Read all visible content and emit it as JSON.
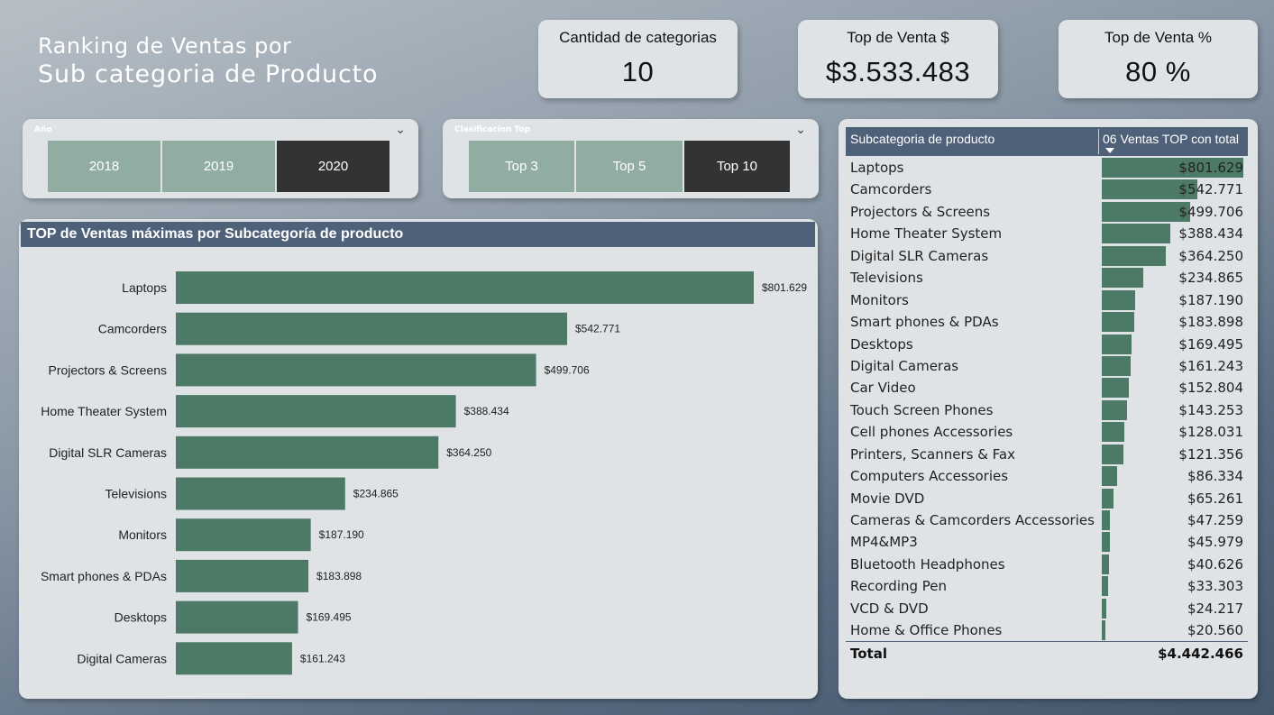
{
  "title": {
    "line1": "Ranking de Ventas por",
    "line2": "Sub categoria de Producto"
  },
  "kpis": [
    {
      "label": "Cantidad de categorias",
      "value": "10"
    },
    {
      "label": "Top de Venta $",
      "value": "$3.533.483"
    },
    {
      "label": "Top de Venta %",
      "value": "80 %"
    }
  ],
  "slicer_year": {
    "label": "Año",
    "options": [
      "2018",
      "2019",
      "2020"
    ],
    "selected": "2020"
  },
  "slicer_top": {
    "label": "Clasificacion Top",
    "options": [
      "Top 3",
      "Top 5",
      "Top 10"
    ],
    "selected": "Top 10"
  },
  "colors": {
    "bar": "#4d7a66",
    "header": "#4e6178",
    "selected_btn": "#333333",
    "btn": "#91ada1"
  },
  "chart_data": {
    "type": "bar",
    "orientation": "horizontal",
    "title": "TOP de Ventas máximas por Subcategoría de producto",
    "categories": [
      "Laptops",
      "Camcorders",
      "Projectors & Screens",
      "Home Theater System",
      "Digital SLR Cameras",
      "Televisions",
      "Monitors",
      "Smart phones & PDAs",
      "Desktops",
      "Digital Cameras"
    ],
    "values": [
      801629,
      542771,
      499706,
      388434,
      364250,
      234865,
      187190,
      183898,
      169495,
      161243
    ],
    "labels": [
      "$801.629",
      "$542.771",
      "$499.706",
      "$388.434",
      "$364.250",
      "$234.865",
      "$187.190",
      "$183.898",
      "$169.495",
      "$161.243"
    ],
    "xlim": [
      0,
      801629
    ],
    "grid": false
  },
  "table": {
    "headers": [
      "Subcategoria de producto",
      "06 Ventas TOP con total"
    ],
    "rows": [
      {
        "name": "Laptops",
        "value": 801629,
        "label": "$801.629"
      },
      {
        "name": "Camcorders",
        "value": 542771,
        "label": "$542.771"
      },
      {
        "name": "Projectors & Screens",
        "value": 499706,
        "label": "$499.706"
      },
      {
        "name": "Home Theater System",
        "value": 388434,
        "label": "$388.434"
      },
      {
        "name": "Digital SLR Cameras",
        "value": 364250,
        "label": "$364.250"
      },
      {
        "name": "Televisions",
        "value": 234865,
        "label": "$234.865"
      },
      {
        "name": "Monitors",
        "value": 187190,
        "label": "$187.190"
      },
      {
        "name": "Smart phones & PDAs",
        "value": 183898,
        "label": "$183.898"
      },
      {
        "name": "Desktops",
        "value": 169495,
        "label": "$169.495"
      },
      {
        "name": "Digital Cameras",
        "value": 161243,
        "label": "$161.243"
      },
      {
        "name": "Car Video",
        "value": 152804,
        "label": "$152.804"
      },
      {
        "name": "Touch Screen Phones",
        "value": 143253,
        "label": "$143.253"
      },
      {
        "name": "Cell phones Accessories",
        "value": 128031,
        "label": "$128.031"
      },
      {
        "name": "Printers, Scanners & Fax",
        "value": 121356,
        "label": "$121.356"
      },
      {
        "name": "Computers Accessories",
        "value": 86334,
        "label": "$86.334"
      },
      {
        "name": "Movie DVD",
        "value": 65261,
        "label": "$65.261"
      },
      {
        "name": "Cameras & Camcorders Accessories",
        "value": 47259,
        "label": "$47.259"
      },
      {
        "name": "MP4&MP3",
        "value": 45979,
        "label": "$45.979"
      },
      {
        "name": "Bluetooth Headphones",
        "value": 40626,
        "label": "$40.626"
      },
      {
        "name": "Recording Pen",
        "value": 33303,
        "label": "$33.303"
      },
      {
        "name": "VCD & DVD",
        "value": 24217,
        "label": "$24.217"
      },
      {
        "name": "Home & Office Phones",
        "value": 20560,
        "label": "$20.560"
      }
    ],
    "total_label": "Total",
    "total_value": "$4.442.466"
  }
}
